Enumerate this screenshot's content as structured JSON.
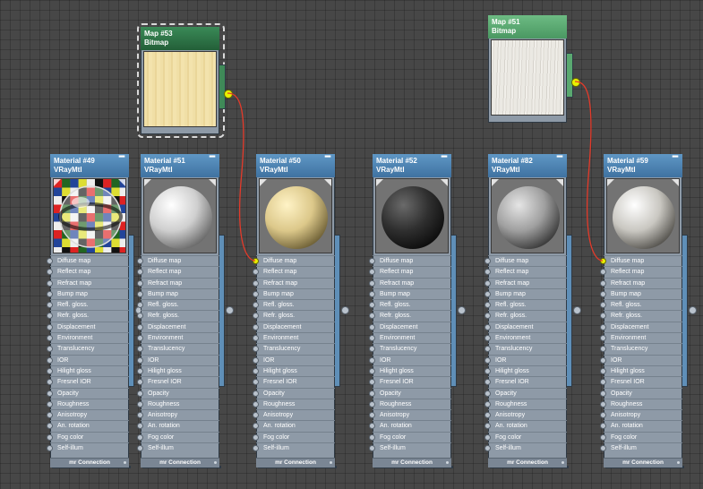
{
  "colors": {
    "canvas_bg": "#474747",
    "material_header": "#4a80b0",
    "bitmap_header_dark": "#2e7a48",
    "bitmap_header_light": "#5aa970",
    "wire": "#e33a2a",
    "active_socket": "#e8f000"
  },
  "bitmaps": [
    {
      "title": "Map #53",
      "subtitle": "Bitmap",
      "texture": "cream",
      "selected": true
    },
    {
      "title": "Map #51",
      "subtitle": "Bitmap",
      "texture": "white-wood",
      "selected": false
    }
  ],
  "materials": [
    {
      "title": "Material #49",
      "subtitle": "VRayMtl",
      "preview": "checker-glass",
      "active_socket": ""
    },
    {
      "title": "Material #51",
      "subtitle": "VRayMtl",
      "preview": "white",
      "active_socket": ""
    },
    {
      "title": "Material #50",
      "subtitle": "VRayMtl",
      "preview": "cream",
      "active_socket": "Diffuse map"
    },
    {
      "title": "Material #52",
      "subtitle": "VRayMtl",
      "preview": "black",
      "active_socket": ""
    },
    {
      "title": "Material #82",
      "subtitle": "VRayMtl",
      "preview": "grey",
      "active_socket": ""
    },
    {
      "title": "Material #59",
      "subtitle": "VRayMtl",
      "preview": "white-wood",
      "active_socket": "Diffuse map"
    }
  ],
  "sockets": [
    "Diffuse map",
    "Reflect map",
    "Refract map",
    "Bump map",
    "Refl. gloss.",
    "Refr. gloss.",
    "Displacement",
    "Environment",
    "Translucency",
    "IOR",
    "Hilight gloss",
    "Fresnel IOR",
    "Opacity",
    "Roughness",
    "Anisotropy",
    "An. rotation",
    "Fog color",
    "Self-illum"
  ],
  "footer_label": "mr Connection",
  "minimize_glyph": "━",
  "icons": {
    "socket": "circle-socket-icon",
    "minimize": "minimize-icon",
    "output": "output-socket-icon"
  }
}
